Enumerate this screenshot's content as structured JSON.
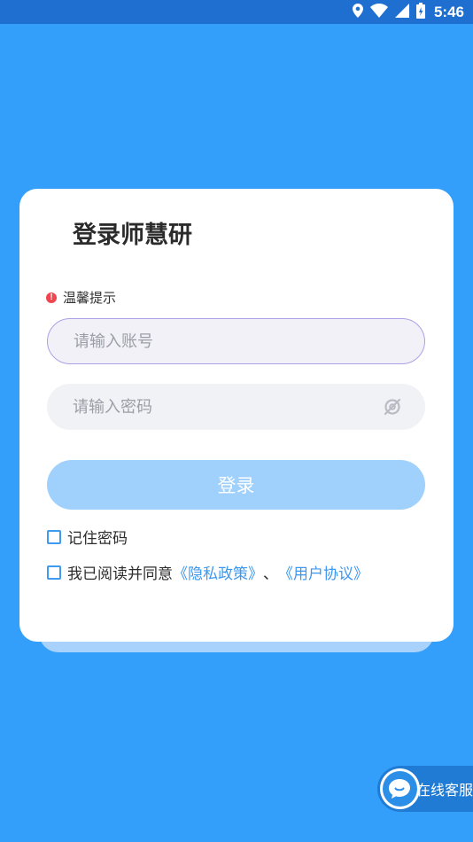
{
  "status_bar": {
    "time": "5:46",
    "icons": [
      "location-icon",
      "wifi-icon",
      "signal-icon",
      "battery-icon"
    ]
  },
  "login": {
    "title": "登录师慧研",
    "tip_label": "温馨提示",
    "tip_icon": "!",
    "account_placeholder": "请输入账号",
    "account_value": "",
    "password_placeholder": "请输入密码",
    "password_value": "",
    "login_button": "登录",
    "remember_label": "记住密码",
    "agree_prefix": "我已阅读并同意",
    "privacy_link": "《隐私政策》",
    "separator": "、",
    "user_agreement_link": "《用户协议》"
  },
  "support": {
    "label": "在线客服"
  },
  "colors": {
    "background": "#339ffb",
    "accent": "#3c97ef",
    "button_disabled": "#9fd1fc",
    "tip": "#f0464f"
  }
}
